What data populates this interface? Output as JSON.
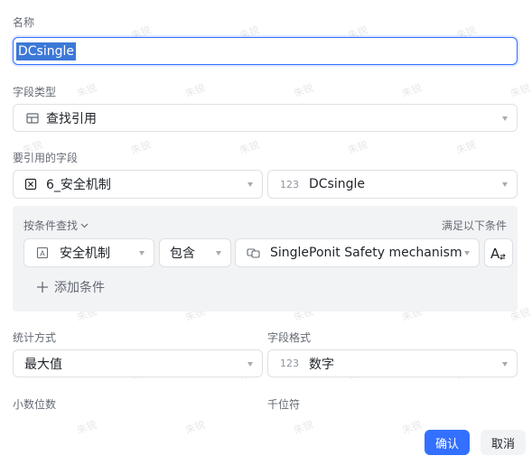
{
  "name": {
    "label": "名称",
    "value": "DCsingle"
  },
  "field_type": {
    "label": "字段类型",
    "value": "查找引用"
  },
  "ref_field": {
    "label": "要引用的字段",
    "table": "6_安全机制",
    "field": "DCsingle"
  },
  "conditions": {
    "lookup_label": "按条件查找",
    "match_label": "满足以下条件",
    "row": {
      "field": "安全机制",
      "operator": "包含",
      "value": "SinglePonit Safety mechanism"
    },
    "add_label": "添加条件"
  },
  "statistics": {
    "label": "统计方式",
    "value": "最大值"
  },
  "format": {
    "label": "字段格式",
    "value": "数字"
  },
  "decimal": {
    "label": "小数位数"
  },
  "thousands": {
    "label": "千位符"
  },
  "icons": {
    "number_glyph": "123"
  },
  "buttons": {
    "confirm": "确认",
    "cancel": "取消"
  },
  "watermark": "朱锐",
  "colors": {
    "accent": "#3370ff",
    "border": "#dee0e3",
    "panel": "#f2f3f5"
  }
}
